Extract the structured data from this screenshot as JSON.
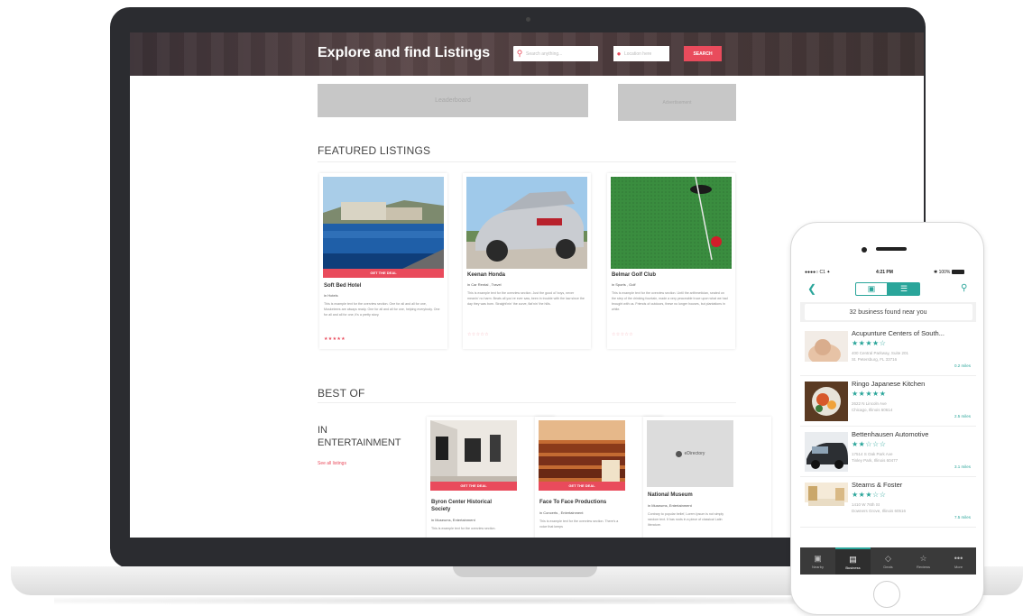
{
  "site": {
    "hero_title": "Explore and find Listings",
    "search_placeholder": "Search anything...",
    "location_placeholder": "Location here",
    "search_button": "SEARCH",
    "ad_leaderboard": "Leaderboard",
    "ad_small": "Advertisement"
  },
  "featured": {
    "title": "FEATURED LISTINGS",
    "cards": [
      {
        "deal": "GET THE DEAL",
        "name": "Soft Bed Hotel",
        "category": "in Hotels",
        "description": "This is example text for the overview section. One for all and all for one, Musketeers are always ready. One for all and all for one, helping everybody. One for all and all for one, it's a pretty story.",
        "rating": 5,
        "max_rating": 5
      },
      {
        "name": "Keenan Honda",
        "category": "in Car Rental , Travel",
        "description": "This is example text for the overview section. Just the good ol' boys, never meanin' no harm. Beats all you've ever saw, been in trouble with the law since the day they was born. Straight'nin' the curve, flat'nin' the hills.",
        "rating": 0,
        "max_rating": 5
      },
      {
        "name": "Belmar Golf Club",
        "category": "in Sports , Golf",
        "description": "This is example text for the overview section. Until the arithmetician, seated on the step of the drinking fountain, made a very peaceable truce upon what we had brought with us. Friends of outdoors, these no longer houses, but plantations in white.",
        "rating": 0,
        "max_rating": 5
      }
    ]
  },
  "best_of": {
    "title": "BEST OF",
    "category_in": "IN",
    "category_name": "ENTERTAINMENT",
    "see_all": "See all listings",
    "cards": [
      {
        "deal": "GET THE DEAL",
        "name_line1": "Byron Center Historical",
        "name_line2": "Society",
        "category": "in Museums, Entertainment",
        "description": "This is example text for the overview section."
      },
      {
        "deal": "GET THE DEAL",
        "name": "Face To Face Productions",
        "category": "in Concerts , Entertainment",
        "description": "This is example text for the overview section. There's a voice that keeps"
      },
      {
        "logo_text": "eDirectory",
        "name": "National Museum",
        "category": "in Museums, Entertainment",
        "description": "Contrary to popular belief, Lorem Ipsum is not simply random text. It has roots in a piece of classical Latin literature."
      }
    ]
  },
  "phone": {
    "status": {
      "carrier": "●●●●○ C1 ✦",
      "time": "4:21 PM",
      "battery": "✱ 100%"
    },
    "results_text": "32 business found near you",
    "businesses": [
      {
        "name": "Acupunture Centers of South...",
        "rating": 4,
        "max_rating": 5,
        "addr1": "400 Central Parkway, Suite 201",
        "addr2": "St. Petersburg, FL 33716",
        "distance": "0.2 miles"
      },
      {
        "name": "Ringo Japanese Kitchen",
        "rating": 5,
        "max_rating": 5,
        "addr1": "2622 N Lincoln Ave",
        "addr2": "Chicago, Illinois 60614",
        "distance": "2.5 miles"
      },
      {
        "name": "Bettenhausen Automotive",
        "rating": 2,
        "max_rating": 5,
        "addr1": "17514 S Oak Park Ave",
        "addr2": "Tinley Park, Illinois 60477",
        "distance": "3.1 miles"
      },
      {
        "name": "Stearns & Foster",
        "rating": 3,
        "max_rating": 5,
        "addr1": "1410 W 76th St",
        "addr2": "Downers Grove, Illinois 60516",
        "distance": "7.5 miles"
      }
    ],
    "tabs": [
      {
        "icon": "▣",
        "label": "Nearby"
      },
      {
        "icon": "▤",
        "label": "Business"
      },
      {
        "icon": "◇",
        "label": "Deals"
      },
      {
        "icon": "☆",
        "label": "Reviews"
      },
      {
        "icon": "•••",
        "label": "More"
      }
    ],
    "active_tab": 1
  },
  "colors": {
    "accent_red": "#e94b5c",
    "accent_teal": "#2aa59a"
  }
}
